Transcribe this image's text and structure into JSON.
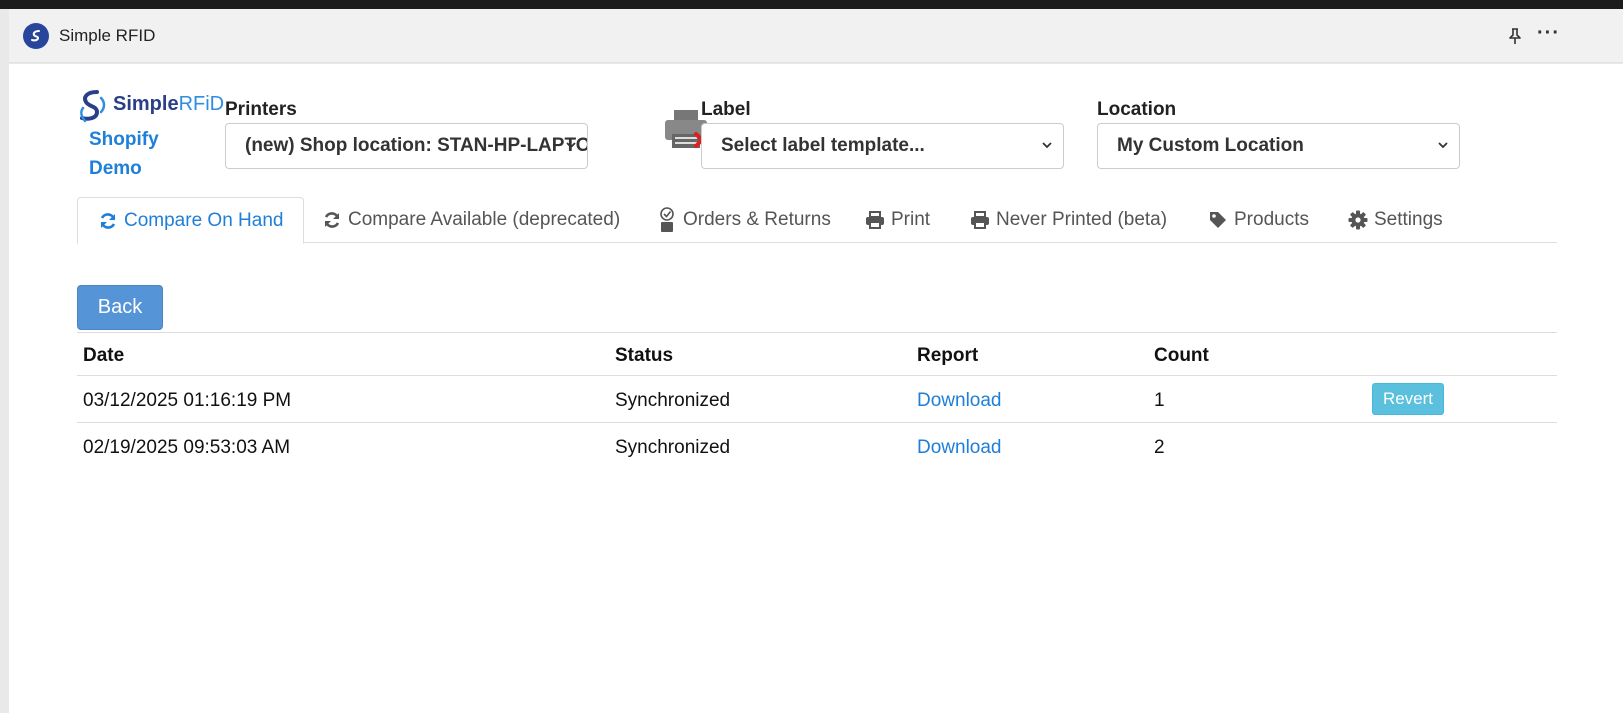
{
  "window": {
    "title": "Simple RFID"
  },
  "brand": {
    "logo_simple": "Simple",
    "logo_rfid": "RFiD",
    "sub1": "Shopify",
    "sub2": "Demo"
  },
  "printers": {
    "label": "Printers",
    "selected": "(new) Shop location: STAN-HP-LAPTOP"
  },
  "label_field": {
    "label": "Label",
    "selected": "Select label template..."
  },
  "location": {
    "label": "Location",
    "selected": "My Custom Location"
  },
  "tabs": [
    {
      "label": "Compare On Hand",
      "icon": "refresh-icon"
    },
    {
      "label": "Compare Available (deprecated)",
      "icon": "refresh-icon"
    },
    {
      "label": "Orders & Returns",
      "icon": "badge-check-icon"
    },
    {
      "label": "Print",
      "icon": "printer-icon"
    },
    {
      "label": "Never Printed (beta)",
      "icon": "printer-icon"
    },
    {
      "label": "Products",
      "icon": "tag-icon"
    },
    {
      "label": "Settings",
      "icon": "gear-icon"
    }
  ],
  "back_label": "Back",
  "table": {
    "headers": {
      "date": "Date",
      "status": "Status",
      "report": "Report",
      "count": "Count"
    },
    "rows": [
      {
        "date": "03/12/2025 01:16:19 PM",
        "status": "Synchronized",
        "report": "Download",
        "count": "1",
        "action": "Revert"
      },
      {
        "date": "02/19/2025 09:53:03 AM",
        "status": "Synchronized",
        "report": "Download",
        "count": "2"
      }
    ]
  },
  "colors": {
    "accent": "#1f7ed8",
    "back_button": "#5694d8",
    "revert_button": "#5bc0de",
    "printer_error": "#e02020"
  }
}
